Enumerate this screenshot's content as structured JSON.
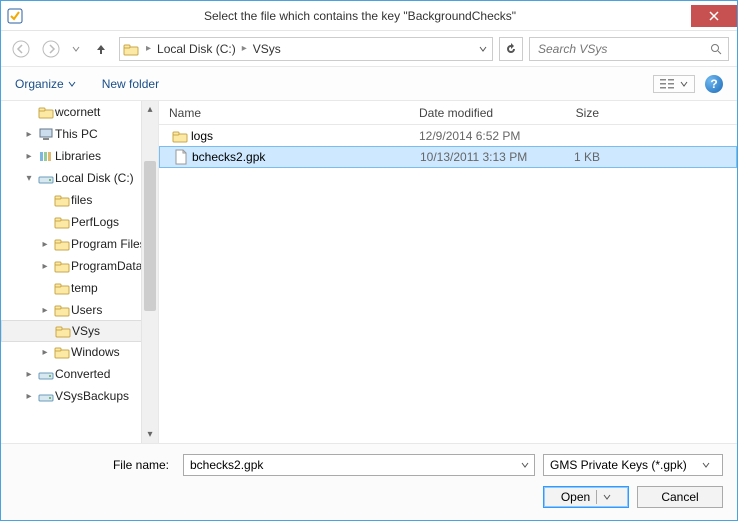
{
  "titlebar": {
    "title": "Select the file which contains the key \"BackgroundChecks\""
  },
  "nav": {
    "breadcrumb": [
      "Local Disk (C:)",
      "VSys"
    ],
    "search_placeholder": "Search VSys"
  },
  "toolbar": {
    "organize": "Organize",
    "newfolder": "New folder"
  },
  "tree": {
    "items": [
      {
        "label": "wcornett",
        "indent": 0,
        "expander": "",
        "icon": "folder"
      },
      {
        "label": "This PC",
        "indent": 0,
        "expander": "▸",
        "icon": "pc"
      },
      {
        "label": "Libraries",
        "indent": 0,
        "expander": "▸",
        "icon": "libraries"
      },
      {
        "label": "Local Disk (C:)",
        "indent": 0,
        "expander": "▾",
        "icon": "drive"
      },
      {
        "label": "files",
        "indent": 1,
        "expander": "",
        "icon": "folder"
      },
      {
        "label": "PerfLogs",
        "indent": 1,
        "expander": "",
        "icon": "folder"
      },
      {
        "label": "Program Files",
        "indent": 1,
        "expander": "▸",
        "icon": "folder"
      },
      {
        "label": "ProgramData",
        "indent": 1,
        "expander": "▸",
        "icon": "folder"
      },
      {
        "label": "temp",
        "indent": 1,
        "expander": "",
        "icon": "folder"
      },
      {
        "label": "Users",
        "indent": 1,
        "expander": "▸",
        "icon": "folder"
      },
      {
        "label": "VSys",
        "indent": 1,
        "expander": "",
        "icon": "folder",
        "selected": true
      },
      {
        "label": "Windows",
        "indent": 1,
        "expander": "▸",
        "icon": "folder"
      },
      {
        "label": "Converted",
        "indent": 0,
        "expander": "▸",
        "icon": "drive"
      },
      {
        "label": "VSysBackups",
        "indent": 0,
        "expander": "▸",
        "icon": "drive"
      }
    ]
  },
  "columns": {
    "name": "Name",
    "date": "Date modified",
    "size": "Size"
  },
  "files": [
    {
      "name": "logs",
      "date": "12/9/2014 6:52 PM",
      "size": "",
      "icon": "folder",
      "selected": false
    },
    {
      "name": "bchecks2.gpk",
      "date": "10/13/2011 3:13 PM",
      "size": "1 KB",
      "icon": "file",
      "selected": true
    }
  ],
  "bottom": {
    "filename_label": "File name:",
    "filename_value": "bchecks2.gpk",
    "filter": "GMS Private Keys (*.gpk)",
    "open": "Open",
    "cancel": "Cancel"
  }
}
